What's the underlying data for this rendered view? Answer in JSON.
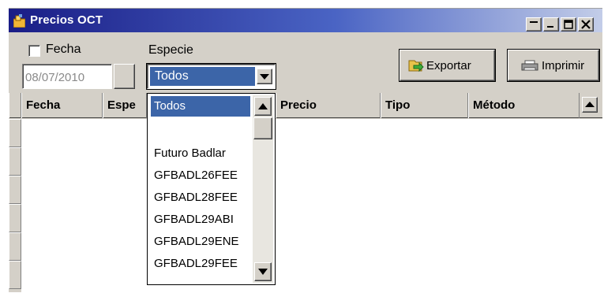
{
  "window": {
    "title": "Precios OCT",
    "controls": [
      "minimize-icon",
      "restore-icon",
      "maximize-icon",
      "close-icon"
    ]
  },
  "filters": {
    "fecha_label": "Fecha",
    "fecha_checked": false,
    "date_value": "08/07/2010",
    "especie_label": "Especie",
    "especie_selected": "Todos"
  },
  "toolbar": {
    "export_label": "Exportar",
    "export_icon": "export-icon",
    "print_label": "Imprimir",
    "print_icon": "printer-icon"
  },
  "grid": {
    "columns": [
      "Fecha",
      "Espe",
      "Precio",
      "Tipo",
      "Método"
    ],
    "rows": []
  },
  "especie_dropdown": {
    "items": [
      "Todos",
      "",
      "Futuro Badlar",
      "GFBADL26FEE",
      "GFBADL28FEE",
      "GFBADL29ABI",
      "GFBADL29ENE",
      "GFBADL29FEE"
    ],
    "selected_index": 0
  },
  "colors": {
    "title_gradient_start": "#1a1d86",
    "title_gradient_end": "#c3cde8",
    "selection": "#3c65a8",
    "face": "#d4d0c8"
  }
}
